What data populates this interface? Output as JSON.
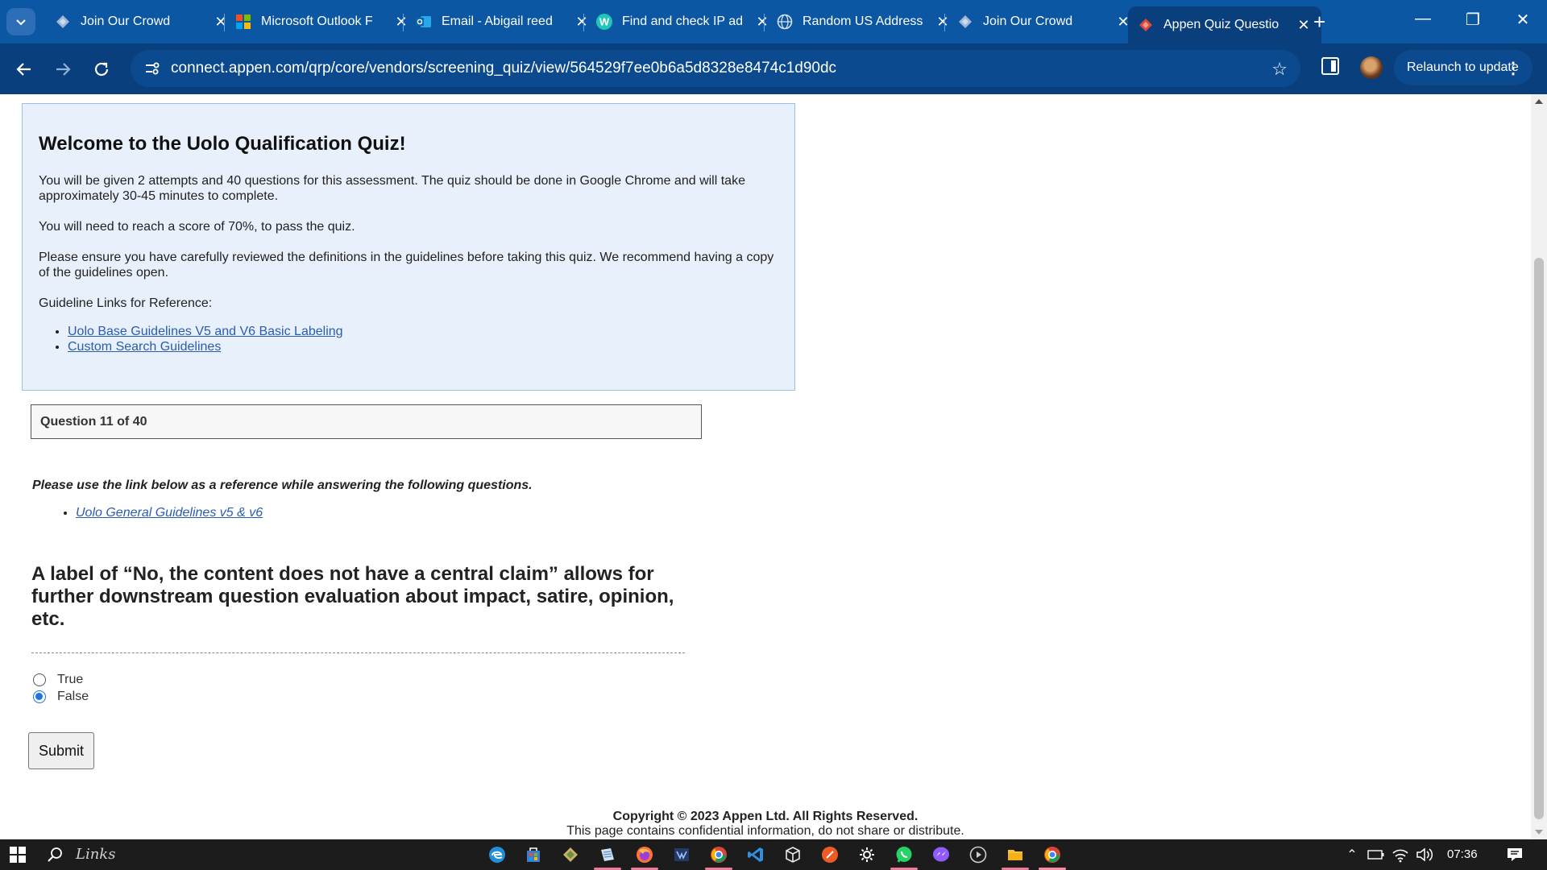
{
  "browser": {
    "tabs": [
      {
        "title": "Join Our Crowd",
        "icon": "appen-diamond-icon",
        "active": false
      },
      {
        "title": "Microsoft Outlook F",
        "icon": "microsoft-logo-icon",
        "active": false
      },
      {
        "title": "Email - Abigail reed",
        "icon": "outlook-icon",
        "active": false
      },
      {
        "title": "Find and check IP ad",
        "icon": "w-logo-icon",
        "active": false
      },
      {
        "title": "Random US Address",
        "icon": "globe-icon",
        "active": false
      },
      {
        "title": "Join Our Crowd",
        "icon": "appen-diamond-icon",
        "active": false
      },
      {
        "title": "Appen Quiz Questio",
        "icon": "appen-red-icon",
        "active": true
      }
    ],
    "url": "connect.appen.com/qrp/core/vendors/screening_quiz/view/564529f7ee0b6a5d8328e8474c1d90dc",
    "relaunch_label": "Relaunch to update"
  },
  "intro": {
    "title": "Welcome to the Uolo Qualification Quiz!",
    "para1": "You will be given 2 attempts and 40 questions for this assessment. The quiz should be done in Google Chrome and will take approximately 30-45 minutes to complete.",
    "para2": "You will need to reach a score of 70%, to pass the quiz.",
    "para3": "Please ensure you have carefully reviewed the definitions in the guidelines before taking this quiz. We recommend having a copy of the guidelines open.",
    "links_heading": "Guideline Links for Reference:",
    "links": [
      "Uolo Base Guidelines V5 and V6 Basic Labeling",
      "Custom Search Guidelines"
    ]
  },
  "quiz": {
    "counter": "Question 11 of 40",
    "reference_note": "Please use the link below as a reference while answering the following questions.",
    "reference_link": "Uolo General Guidelines v5 & v6",
    "question": "A label of “No, the content does not have a central claim” allows for further downstream question evaluation about impact, satire, opinion, etc.",
    "options": [
      {
        "label": "True",
        "selected": false
      },
      {
        "label": "False",
        "selected": true
      }
    ],
    "submit_label": "Submit"
  },
  "footer": {
    "copyright": "Copyright © 2023 Appen Ltd. All Rights Reserved.",
    "notice": "This page contains confidential information, do not share or distribute."
  },
  "taskbar": {
    "search_text": "Links",
    "time": "07:36"
  },
  "colors": {
    "tabstrip": "#0b57a4",
    "toolbar": "#0a3f7d",
    "intro_bg": "#e8f0fb",
    "link": "#2a5db0",
    "radio_selected": "#1a73e8"
  }
}
